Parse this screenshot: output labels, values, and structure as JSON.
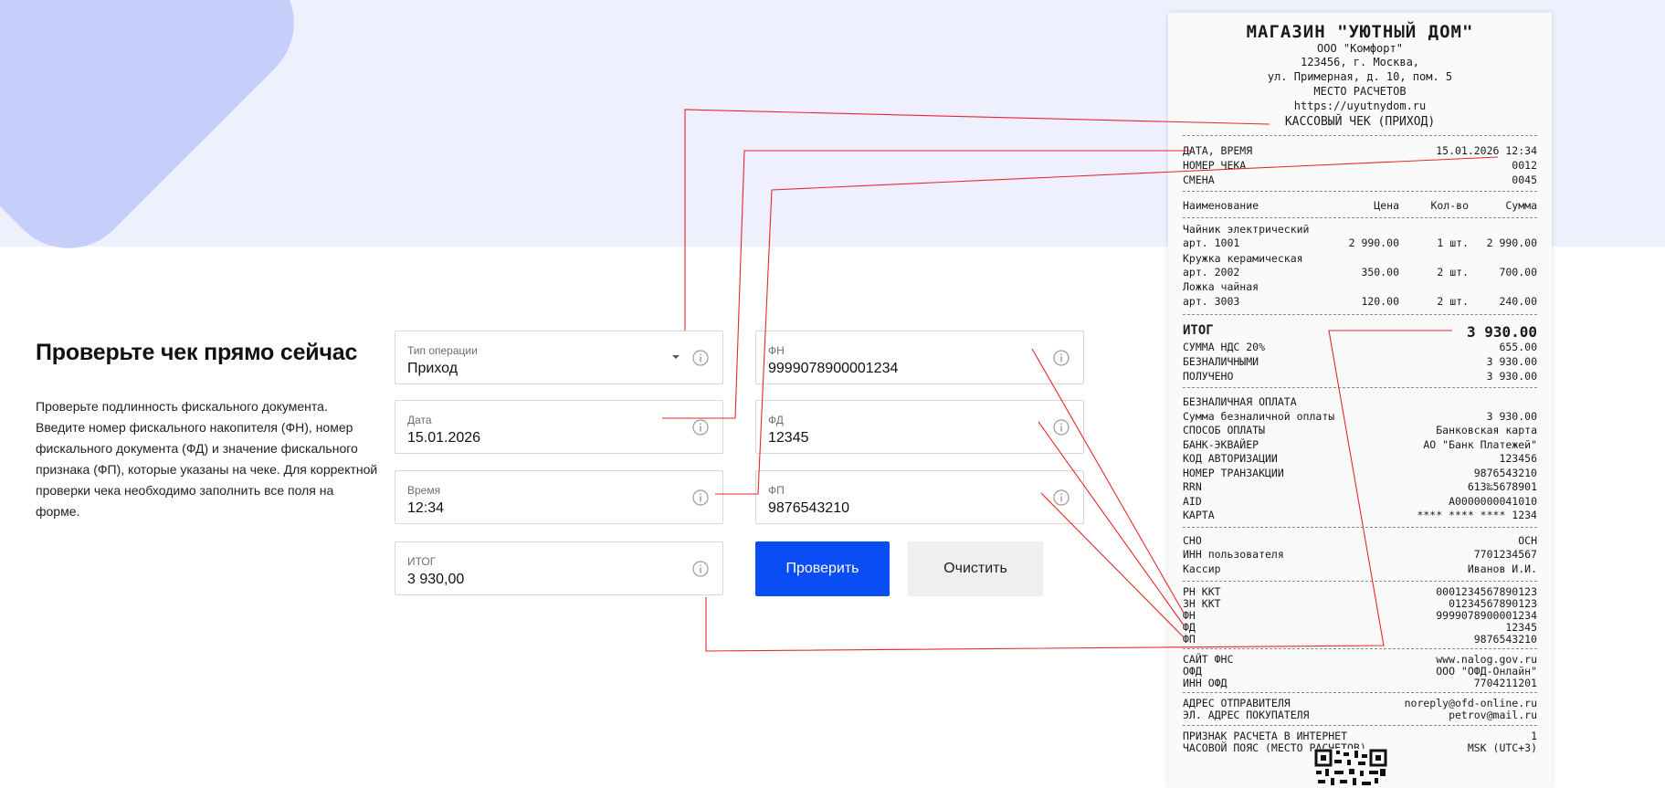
{
  "page": {
    "title": "Проверьте чек прямо сейчас",
    "description": "Проверьте подлинность фискального документа. Введите номер фискального накопителя (ФН), номер фискального документа (ФД) и значение фискального признака (ФП), которые указаны на чеке. Для корректной проверки чека необходимо заполнить все поля на форме."
  },
  "form": {
    "operation": {
      "label": "Тип операции",
      "value": "Приход"
    },
    "date": {
      "label": "Дата",
      "value": "15.01.2026"
    },
    "time": {
      "label": "Время",
      "value": "12:34"
    },
    "total": {
      "label": "ИТОГ",
      "value": "3 930,00"
    },
    "fn": {
      "label": "ФН",
      "value": "9999078900001234"
    },
    "fd": {
      "label": "ФД",
      "value": "12345"
    },
    "fp": {
      "label": "ФП",
      "value": "9876543210"
    },
    "check_button": "Проверить",
    "clear_button": "Очистить"
  },
  "receipt": {
    "shop": "МАГАЗИН \"УЮТНЫЙ ДОМ\"",
    "org": "ООО \"Комфорт\"",
    "address1": "123456, г. Москва,",
    "address2": "ул. Примерная, д. 10, пом. 5",
    "place": "МЕСТО РАСЧЕТОВ",
    "site": "https://uyutnydom.ru",
    "doc_type": "КАССОВЫЙ ЧЕК (ПРИХОД)",
    "header_rows": [
      {
        "label": "ДАТА, ВРЕМЯ",
        "value": "15.01.2026 12:34"
      },
      {
        "label": "НОМЕР ЧЕКА",
        "value": "0012"
      },
      {
        "label": "СМЕНА",
        "value": "0045"
      }
    ],
    "columns": {
      "name": "Наименование",
      "price": "Цена",
      "qty": "Кол-во",
      "sum": "Сумма"
    },
    "items": [
      {
        "name": "Чайник электрический",
        "art": "арт. 1001",
        "price": "2 990.00",
        "qty": "1 шт.",
        "sum": "2 990.00"
      },
      {
        "name": "Кружка керамическая",
        "art": "арт. 2002",
        "price": "350.00",
        "qty": "2 шт.",
        "sum": "700.00"
      },
      {
        "name": "Ложка чайная",
        "art": "арт. 3003",
        "price": "120.00",
        "qty": "2 шт.",
        "sum": "240.00"
      }
    ],
    "total_label": "ИТОГ",
    "total_value": "3 930.00",
    "summary_rows": [
      {
        "label": "СУММА НДС 20%",
        "value": "655.00"
      },
      {
        "label": "БЕЗНАЛИЧНЫМИ",
        "value": "3 930.00"
      },
      {
        "label": "ПОЛУЧЕНО",
        "value": "3 930.00"
      }
    ],
    "cashless_title": "БЕЗНАЛИЧНАЯ ОПЛАТА",
    "payment_rows": [
      {
        "label": "Сумма безналичной оплаты",
        "value": "3 930.00"
      },
      {
        "label": "СПОСОБ ОПЛАТЫ",
        "value": "Банковская карта"
      },
      {
        "label": "БАНК-ЭКВАЙЕР",
        "value": "АО \"Банк Платежей\""
      },
      {
        "label": "КОД АВТОРИЗАЦИИ",
        "value": "123456"
      },
      {
        "label": "НОМЕР ТРАНЗАКЦИИ",
        "value": "9876543210"
      },
      {
        "label": "RRN",
        "value": "613‰5678901"
      },
      {
        "label": "AID",
        "value": "A0000000041010"
      },
      {
        "label": "КАРТА",
        "value": "**** **** **** 1234"
      }
    ],
    "tax_rows": [
      {
        "label": "СНО",
        "value": "ОСН"
      },
      {
        "label": "ИНН пользователя",
        "value": "7701234567"
      },
      {
        "label": "Кассир",
        "value": "Иванов И.И."
      }
    ],
    "fiscal_rows": [
      {
        "label": "РН ККТ",
        "value": "0001234567890123"
      },
      {
        "label": "ЗН ККТ",
        "value": "01234567890123"
      },
      {
        "label": "ФН",
        "value": "9999078900001234"
      },
      {
        "label": "ФД",
        "value": "12345"
      },
      {
        "label": "ФП",
        "value": "9876543210"
      }
    ],
    "ofd_rows": [
      {
        "label": "САЙТ ФНС",
        "value": "www.nalog.gov.ru"
      },
      {
        "label": "ОФД",
        "value": "ООО \"ОФД-Онлайн\""
      },
      {
        "label": "ИНН ОФД",
        "value": "7704211201"
      }
    ],
    "email_rows": [
      {
        "label": "АДРЕС ОТПРАВИТЕЛЯ",
        "value": "noreply@ofd-online.ru"
      },
      {
        "label": "ЭЛ. АДРЕС ПОКУПАТЕЛЯ",
        "value": "petrov@mail.ru"
      }
    ],
    "footer_rows": [
      {
        "label": "ПРИЗНАК РАСЧЕТА В ИНТЕРНЕТ",
        "value": "1"
      },
      {
        "label": "ЧАСОВОЙ ПОЯС (МЕСТО РАСЧЕТОВ)",
        "value": "MSK (UTC+3)"
      }
    ]
  },
  "icons": {
    "info": "info-circle-icon",
    "dropdown": "caret-down-icon",
    "qr": "qr-code-icon"
  },
  "colors": {
    "primary": "#0b4df5",
    "secondary": "#efefef",
    "band": "#eef0fd",
    "shape": "#c6cefa",
    "annotation": "#e8262a"
  }
}
